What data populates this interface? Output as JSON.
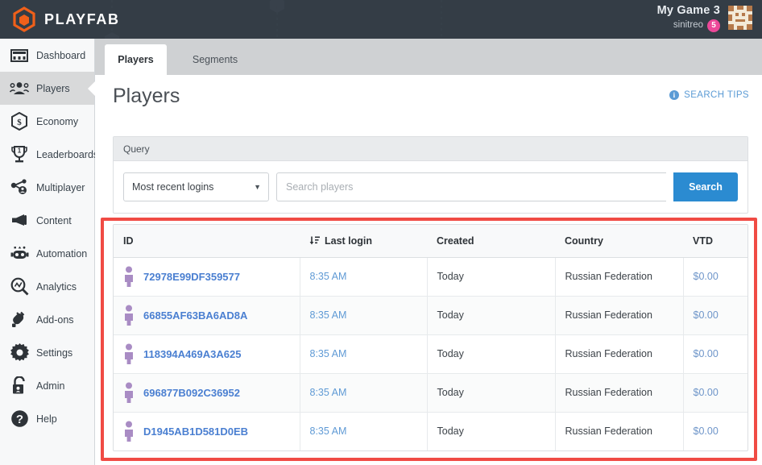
{
  "header": {
    "brand": "PLAYFAB",
    "brand_logo_icon": "playfab-hexagon-logo",
    "accent_orange": "#f0601a",
    "game_name": "My Game 3",
    "username": "sinitreo",
    "notification_count": "5",
    "badge_color": "#ec4899",
    "game_avatar_icon": "pixel-game-avatar"
  },
  "sidebar": {
    "items": [
      {
        "label": "Dashboard",
        "icon": "dashboard-icon",
        "active": false
      },
      {
        "label": "Players",
        "icon": "players-icon",
        "active": true
      },
      {
        "label": "Economy",
        "icon": "economy-icon",
        "active": false
      },
      {
        "label": "Leaderboards",
        "icon": "leaderboards-icon",
        "active": false
      },
      {
        "label": "Multiplayer",
        "icon": "multiplayer-icon",
        "active": false
      },
      {
        "label": "Content",
        "icon": "content-icon",
        "active": false
      },
      {
        "label": "Automation",
        "icon": "automation-icon",
        "active": false
      },
      {
        "label": "Analytics",
        "icon": "analytics-icon",
        "active": false
      },
      {
        "label": "Add-ons",
        "icon": "addons-icon",
        "active": false
      },
      {
        "label": "Settings",
        "icon": "settings-icon",
        "active": false
      },
      {
        "label": "Admin",
        "icon": "admin-icon",
        "active": false
      },
      {
        "label": "Help",
        "icon": "help-icon",
        "active": false
      }
    ]
  },
  "tabs": {
    "active": "Players",
    "inactive": "Segments"
  },
  "page": {
    "title": "Players",
    "search_tips_label": "SEARCH TIPS",
    "search_tips_icon": "info-icon"
  },
  "query": {
    "panel_title": "Query",
    "select_value": "Most recent logins",
    "select_options": [
      "Most recent logins"
    ],
    "search_placeholder": "Search players",
    "search_value": "",
    "search_button_label": "Search",
    "search_button_color": "#2b8bd1"
  },
  "table": {
    "columns": [
      "ID",
      "Last login",
      "Created",
      "Country",
      "VTD"
    ],
    "sorted_column": "Last login",
    "sort_icon": "sort-descending-icon",
    "rows": [
      {
        "id": "72978E99DF359577",
        "last_login": "8:35 AM",
        "created": "Today",
        "country": "Russian Federation",
        "vtd": "$0.00"
      },
      {
        "id": "66855AF63BA6AD8A",
        "last_login": "8:35 AM",
        "created": "Today",
        "country": "Russian Federation",
        "vtd": "$0.00"
      },
      {
        "id": "118394A469A3A625",
        "last_login": "8:35 AM",
        "created": "Today",
        "country": "Russian Federation",
        "vtd": "$0.00"
      },
      {
        "id": "696877B092C36952",
        "last_login": "8:35 AM",
        "created": "Today",
        "country": "Russian Federation",
        "vtd": "$0.00"
      },
      {
        "id": "D1945AB1D581D0EB",
        "last_login": "8:35 AM",
        "created": "Today",
        "country": "Russian Federation",
        "vtd": "$0.00"
      }
    ]
  },
  "annotation": {
    "highlight_color": "#f04b44"
  }
}
